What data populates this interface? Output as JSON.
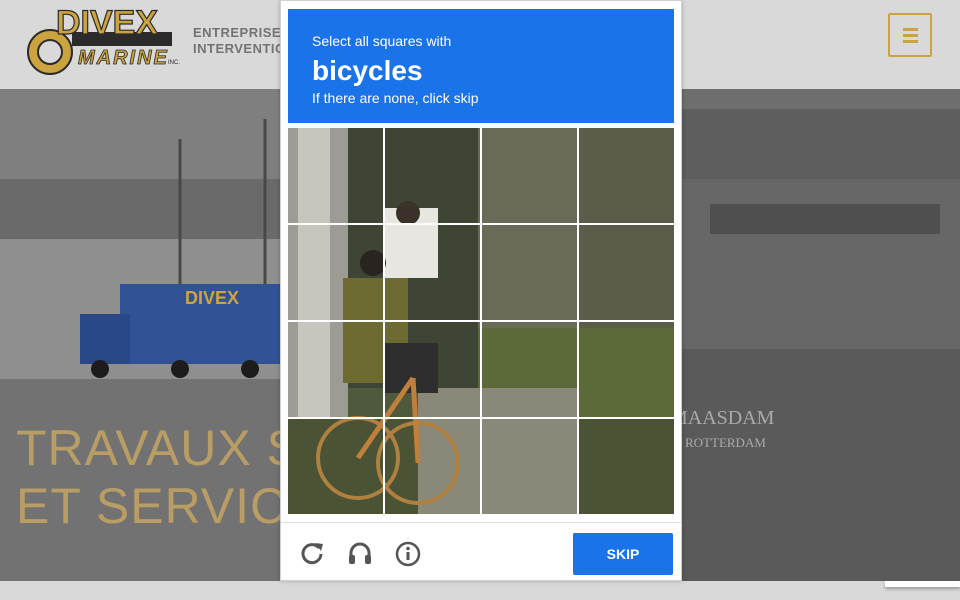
{
  "header": {
    "tagline_line1": "ENTREPRISE",
    "tagline_line2": "INTERVENTIO",
    "logo_text_top": "DIVEX",
    "logo_text_bottom": "MARINE",
    "logo_suffix": "INC."
  },
  "hero": {
    "title_line1": "TRAVAUX SO",
    "title_line2": "ET SERVICE",
    "truck_text": "DIVEX",
    "ship_name": "MAASDAM",
    "ship_port": "ROTTERDAM"
  },
  "captcha": {
    "instruction": "Select all squares with",
    "target": "bicycles",
    "hint": "If there are none, click skip",
    "skip_label": "SKIP",
    "icons": [
      "reload-icon",
      "audio-icon",
      "info-icon"
    ]
  },
  "colors": {
    "accent_blue": "#1a73e8",
    "brand_gold": "#f0c14b",
    "hero_text": "#d9b977"
  }
}
